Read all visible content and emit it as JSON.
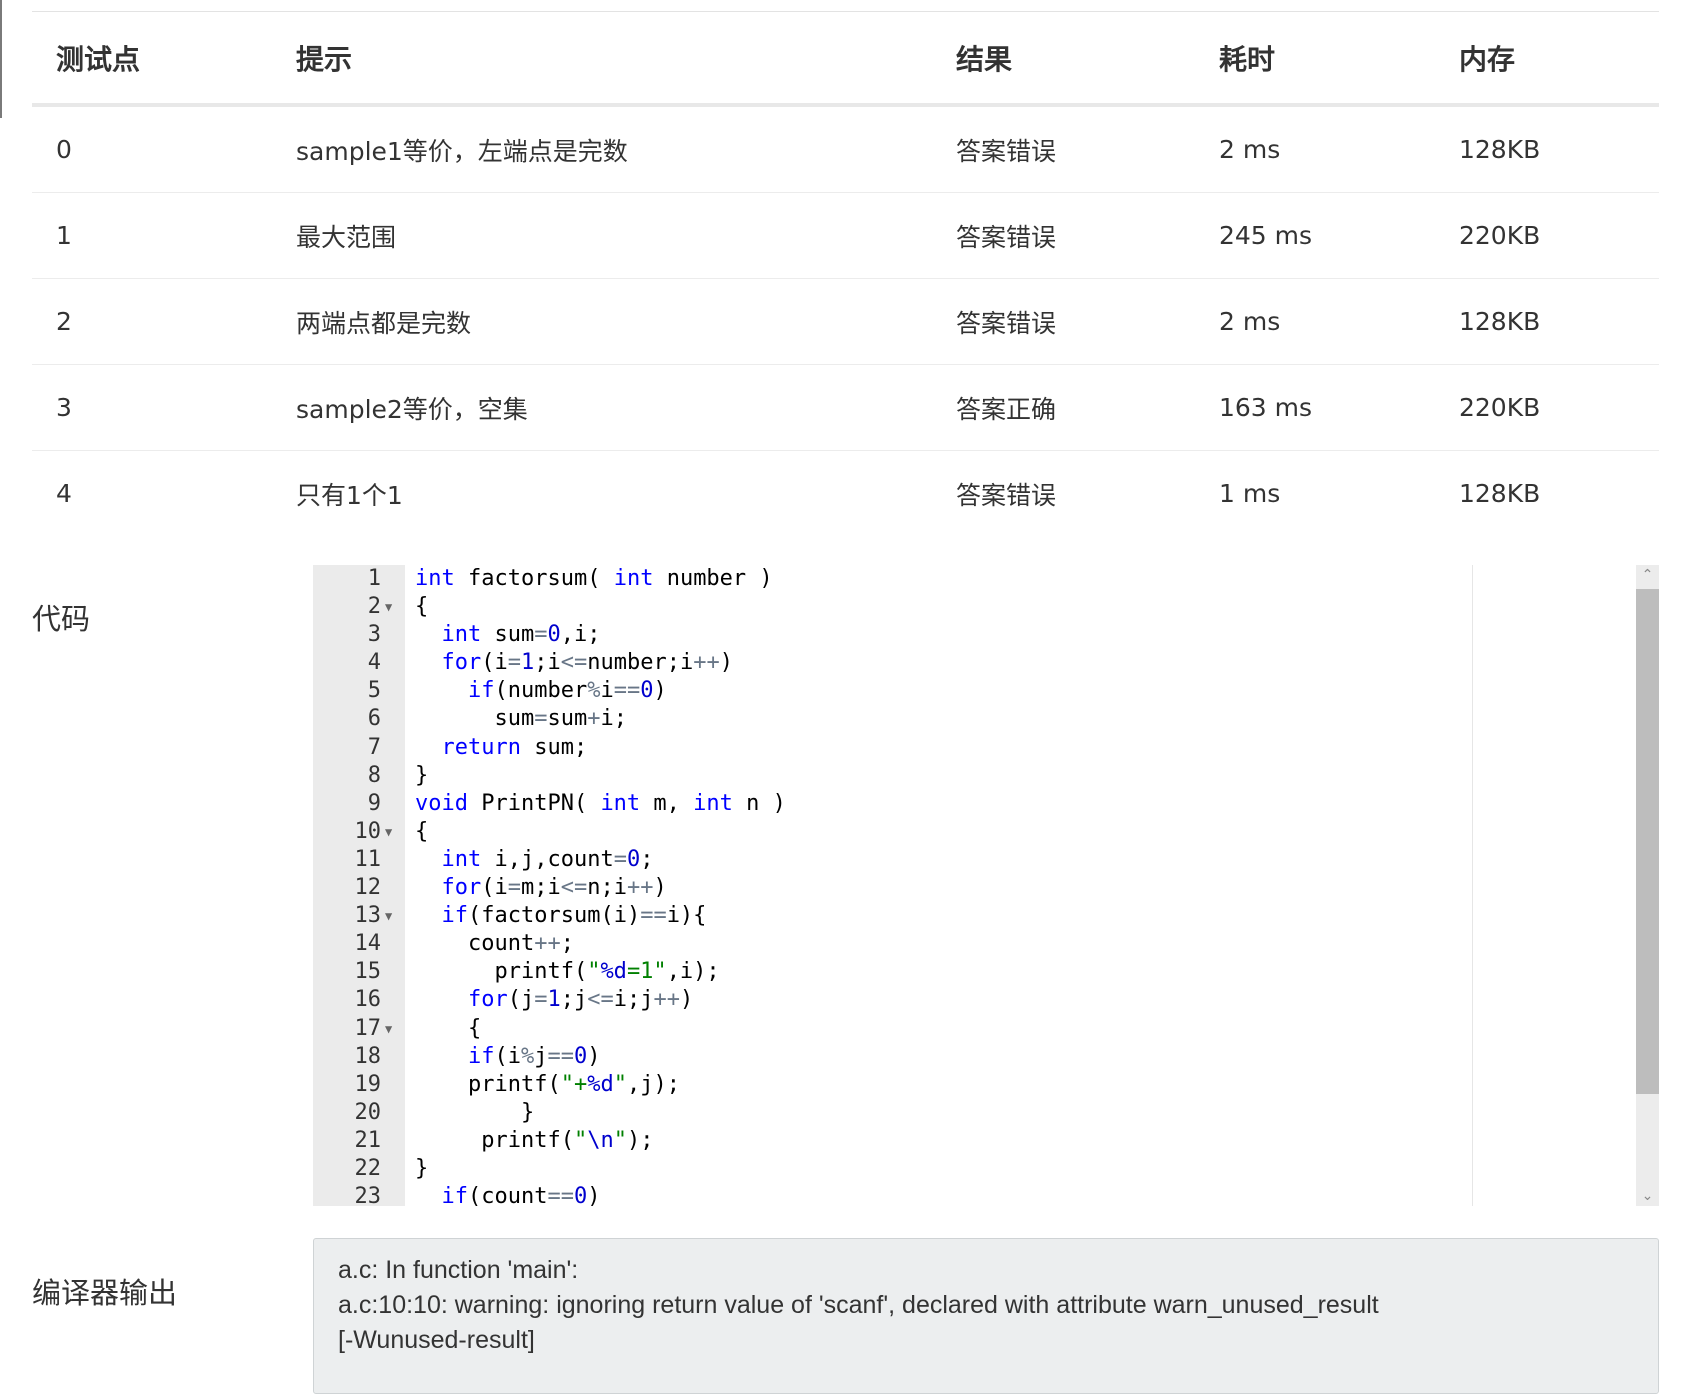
{
  "results_table": {
    "headers": {
      "case": "测试点",
      "hint": "提示",
      "result": "结果",
      "time": "耗时",
      "memory": "内存"
    },
    "rows": [
      {
        "case": "0",
        "hint": "sample1等价，左端点是完数",
        "result": "答案错误",
        "time": "2 ms",
        "memory": "128KB"
      },
      {
        "case": "1",
        "hint": "最大范围",
        "result": "答案错误",
        "time": "245 ms",
        "memory": "220KB"
      },
      {
        "case": "2",
        "hint": "两端点都是完数",
        "result": "答案错误",
        "time": "2 ms",
        "memory": "128KB"
      },
      {
        "case": "3",
        "hint": "sample2等价，空集",
        "result": "答案正确",
        "time": "163 ms",
        "memory": "220KB"
      },
      {
        "case": "4",
        "hint": "只有1个1",
        "result": "答案错误",
        "time": "1 ms",
        "memory": "128KB"
      }
    ]
  },
  "colors": {
    "wrong_answer": "#3c9e3c",
    "accepted": "#e0312b",
    "keyword": "#0000ff",
    "number": "#0000cd",
    "string": "#008000",
    "operator": "#687687"
  },
  "code_section": {
    "label": "代码",
    "lines": [
      {
        "n": "1",
        "fold": false,
        "text": "int factorsum( int number )"
      },
      {
        "n": "2",
        "fold": true,
        "text": "{"
      },
      {
        "n": "3",
        "fold": false,
        "text": "  int sum=0,i;"
      },
      {
        "n": "4",
        "fold": false,
        "text": "  for(i=1;i<=number;i++)"
      },
      {
        "n": "5",
        "fold": false,
        "text": "    if(number%i==0)"
      },
      {
        "n": "6",
        "fold": false,
        "text": "      sum=sum+i;"
      },
      {
        "n": "7",
        "fold": false,
        "text": "  return sum;"
      },
      {
        "n": "8",
        "fold": false,
        "text": "}"
      },
      {
        "n": "9",
        "fold": false,
        "text": "void PrintPN( int m, int n )"
      },
      {
        "n": "10",
        "fold": true,
        "text": "{"
      },
      {
        "n": "11",
        "fold": false,
        "text": "  int i,j,count=0;"
      },
      {
        "n": "12",
        "fold": false,
        "text": "  for(i=m;i<=n;i++)"
      },
      {
        "n": "13",
        "fold": true,
        "text": "  if(factorsum(i)==i){"
      },
      {
        "n": "14",
        "fold": false,
        "text": "    count++;"
      },
      {
        "n": "15",
        "fold": false,
        "text": "      printf(\"%d=1\",i);"
      },
      {
        "n": "16",
        "fold": false,
        "text": "    for(j=1;j<=i;j++)"
      },
      {
        "n": "17",
        "fold": true,
        "text": "    {"
      },
      {
        "n": "18",
        "fold": false,
        "text": "    if(i%j==0)"
      },
      {
        "n": "19",
        "fold": false,
        "text": "    printf(\"+%d\",j);"
      },
      {
        "n": "20",
        "fold": false,
        "text": "        }"
      },
      {
        "n": "21",
        "fold": false,
        "text": "     printf(\"\\n\");"
      },
      {
        "n": "22",
        "fold": false,
        "text": "}"
      },
      {
        "n": "23",
        "fold": false,
        "text": "  if(count==0)"
      }
    ]
  },
  "compiler_section": {
    "label": "编译器输出",
    "lines": [
      "a.c: In function 'main':",
      "a.c:10:10: warning: ignoring return value of 'scanf', declared with attribute warn_unused_result",
      "[-Wunused-result]"
    ]
  }
}
